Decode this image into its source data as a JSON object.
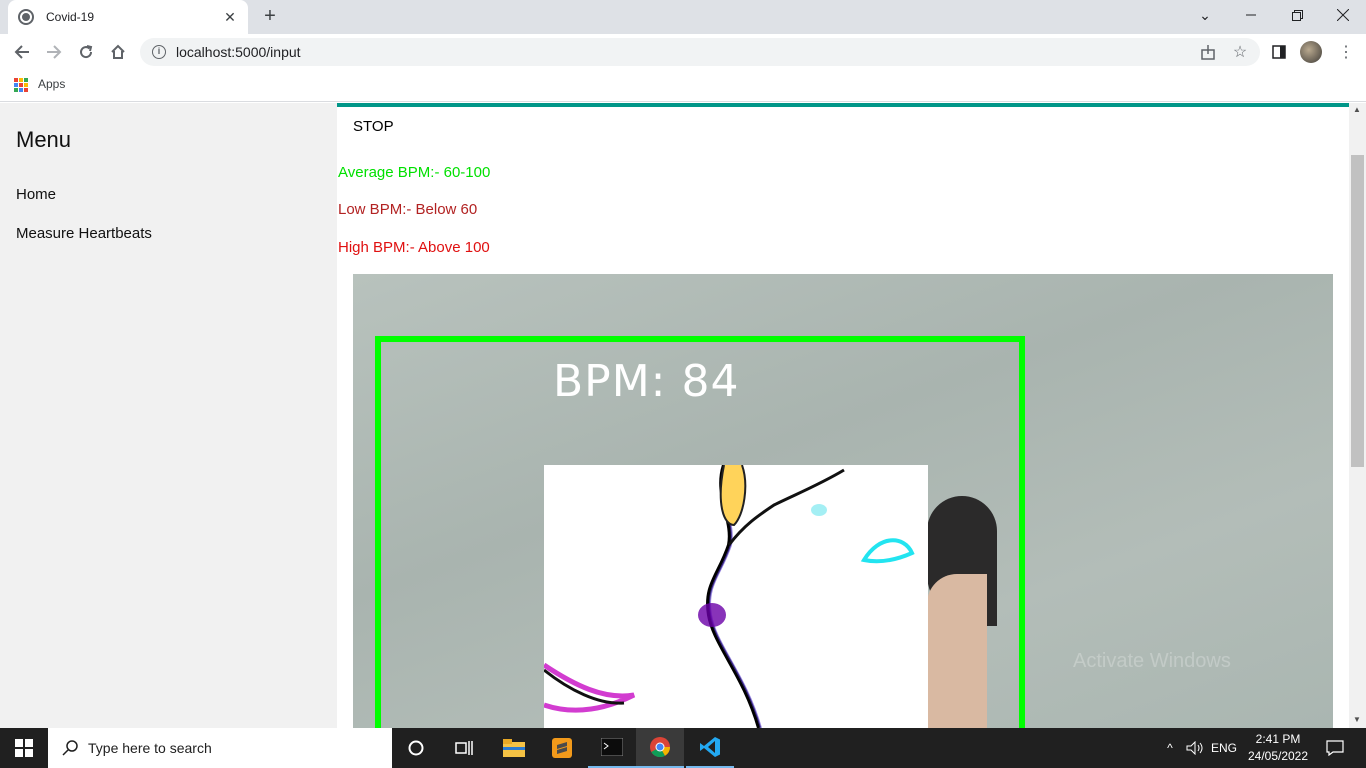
{
  "browser": {
    "tab_title": "Covid-19",
    "url": "localhost:5000/input",
    "bookmarks_apps_label": "Apps"
  },
  "sidebar": {
    "title": "Menu",
    "items": [
      {
        "label": "Home"
      },
      {
        "label": "Measure Heartbeats"
      }
    ]
  },
  "main": {
    "stop_label": "STOP",
    "bpm_info": [
      {
        "text": "Average BPM:- 60-100",
        "color": "#00e000"
      },
      {
        "text": "Low BPM:- Below 60",
        "color": "#b22222"
      },
      {
        "text": "High BPM:- Above 100",
        "color": "#e01010"
      }
    ],
    "video": {
      "overlay_text": "BPM: 84",
      "watermark": "Activate Windows"
    }
  },
  "taskbar": {
    "search_placeholder": "Type here to search",
    "language": "ENG",
    "time": "2:41 PM",
    "date": "24/05/2022"
  },
  "colors": {
    "accent_bar": "#009688",
    "face_box": "#00ff00"
  }
}
